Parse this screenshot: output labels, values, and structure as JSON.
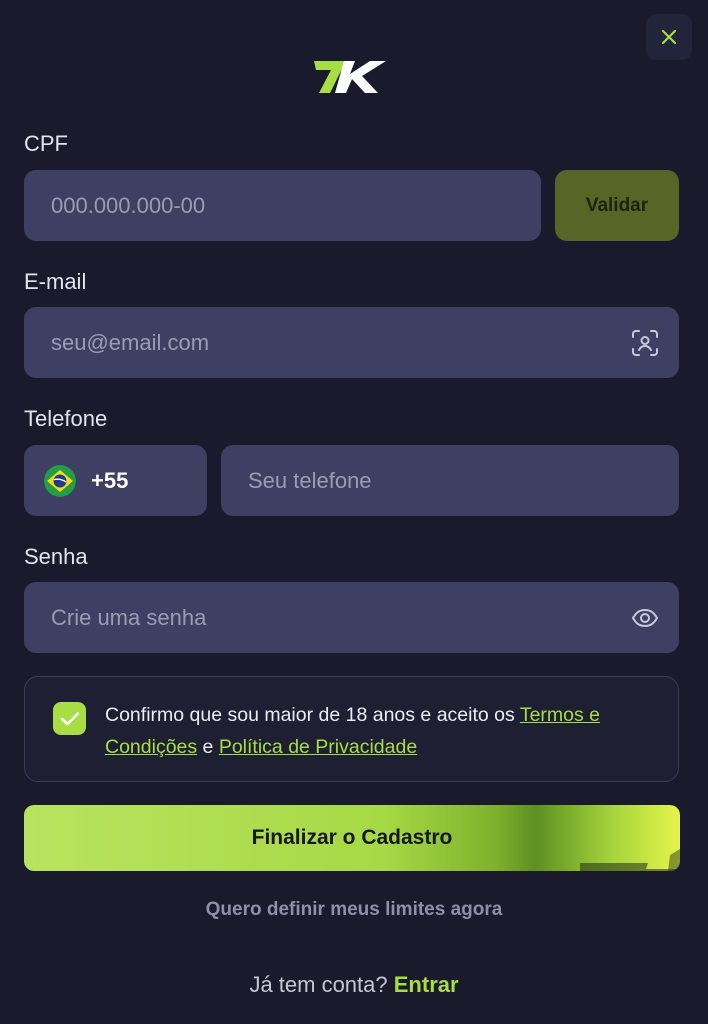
{
  "header": {
    "close_icon": "close-icon",
    "logo_text": "7K"
  },
  "form": {
    "cpf": {
      "label": "CPF",
      "placeholder": "000.000.000-00",
      "validate_label": "Validar"
    },
    "email": {
      "label": "E-mail",
      "placeholder": "seu@email.com",
      "icon": "face-scan-icon"
    },
    "phone": {
      "label": "Telefone",
      "country_flag": "brazil-flag-icon",
      "dial_code": "+55",
      "placeholder": "Seu telefone"
    },
    "password": {
      "label": "Senha",
      "placeholder": "Crie uma senha",
      "icon": "eye-icon"
    },
    "terms": {
      "checked": true,
      "text_before": "Confirmo que sou maior de 18 anos e aceito os ",
      "terms_link": "Termos e Condições",
      "connector": " e ",
      "privacy_link": "Política de Privacidade"
    },
    "submit_label": "Finalizar o Cadastro",
    "limits_link": "Quero definir meus limites agora"
  },
  "footer": {
    "prompt": "Já tem conta?",
    "login_link": "Entrar"
  },
  "colors": {
    "background": "#191a2c",
    "field": "#3f3f63",
    "accent": "#a8dd43",
    "validate_button": "#576627"
  }
}
